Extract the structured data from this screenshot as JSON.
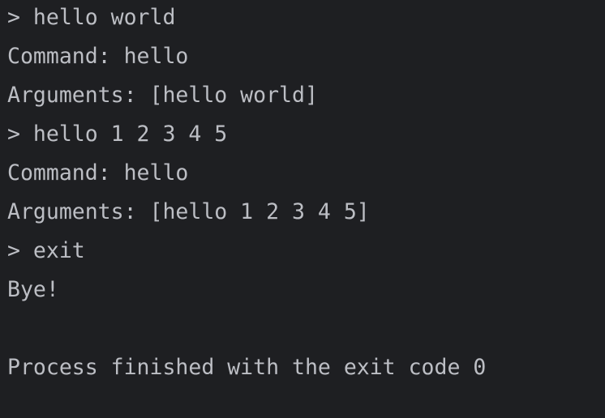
{
  "console": {
    "text_color": "#bcbec4",
    "background": "#1e1f22",
    "lines": [
      "> hello world",
      "Command: hello",
      "Arguments: [hello world]",
      "> hello 1 2 3 4 5",
      "Command: hello",
      "Arguments: [hello 1 2 3 4 5]",
      "> exit",
      "Bye!",
      "",
      "Process finished with the exit code 0"
    ]
  }
}
